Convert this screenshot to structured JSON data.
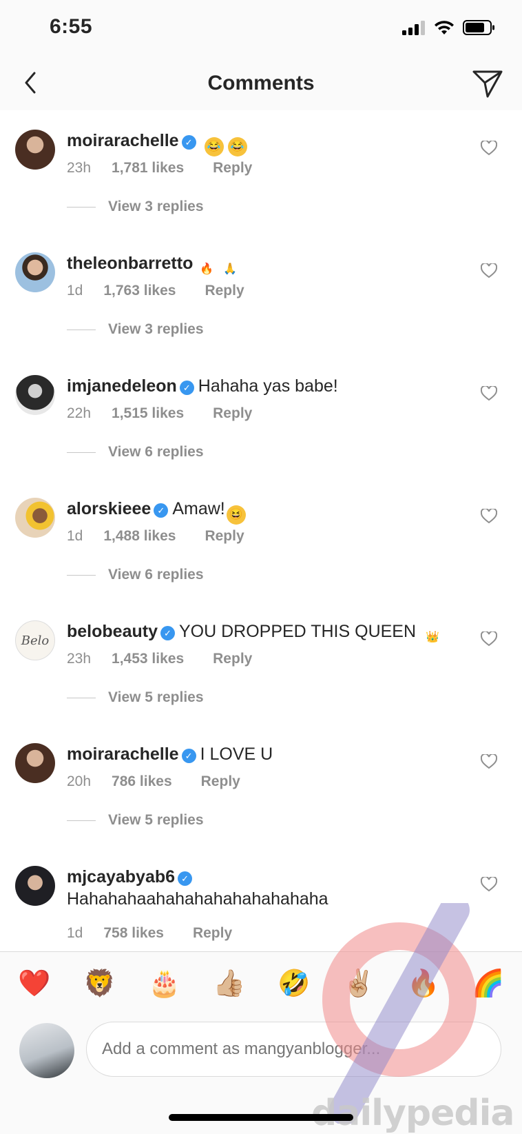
{
  "status_bar": {
    "time": "6:55"
  },
  "header": {
    "title": "Comments"
  },
  "comments": [
    {
      "username": "moirarachelle",
      "verified": true,
      "text": "",
      "emojis": [
        "face-with-tears-of-joy",
        "face-with-tears-of-joy"
      ],
      "time": "23h",
      "likes": "1,781 likes",
      "reply": "Reply",
      "view_replies": "View 3 replies"
    },
    {
      "username": "theleonbarretto",
      "verified": false,
      "text": "",
      "emojis": [
        "fire",
        "folded-hands"
      ],
      "time": "1d",
      "likes": "1,763 likes",
      "reply": "Reply",
      "view_replies": "View 3 replies"
    },
    {
      "username": "imjanedeleon",
      "verified": true,
      "text": "Hahaha yas babe!",
      "emojis": [],
      "time": "22h",
      "likes": "1,515 likes",
      "reply": "Reply",
      "view_replies": "View 6 replies"
    },
    {
      "username": "alorskieee",
      "verified": true,
      "text": "Amaw!",
      "emojis": [
        "grinning-squinting-face"
      ],
      "time": "1d",
      "likes": "1,488 likes",
      "reply": "Reply",
      "view_replies": "View 6 replies"
    },
    {
      "username": "belobeauty",
      "verified": true,
      "text": "YOU DROPPED THIS QUEEN",
      "emojis": [
        "crown"
      ],
      "time": "23h",
      "likes": "1,453 likes",
      "reply": "Reply",
      "view_replies": "View 5 replies",
      "avatar_text": "Belo"
    },
    {
      "username": "moirarachelle",
      "verified": true,
      "text": "I LOVE U",
      "emojis": [],
      "time": "20h",
      "likes": "786 likes",
      "reply": "Reply",
      "view_replies": "View 5 replies"
    },
    {
      "username": "mjcayabyab6",
      "verified": true,
      "text": "Hahahahaahahahahahahahahaha",
      "emojis": [],
      "time": "1d",
      "likes": "758 likes",
      "reply": "Reply",
      "view_replies": ""
    }
  ],
  "emoji_bar": [
    "❤️",
    "🦁",
    "🎂",
    "👍🏼",
    "🤣",
    "✌🏼",
    "🔥",
    "🌈"
  ],
  "composer": {
    "placeholder": "Add a comment as mangyanblogger..."
  },
  "watermark": {
    "text": "dailypedia"
  },
  "colors": {
    "verified": "#3897f0",
    "secondary_text": "#8e8e8e",
    "divider": "#dbdbdb"
  }
}
